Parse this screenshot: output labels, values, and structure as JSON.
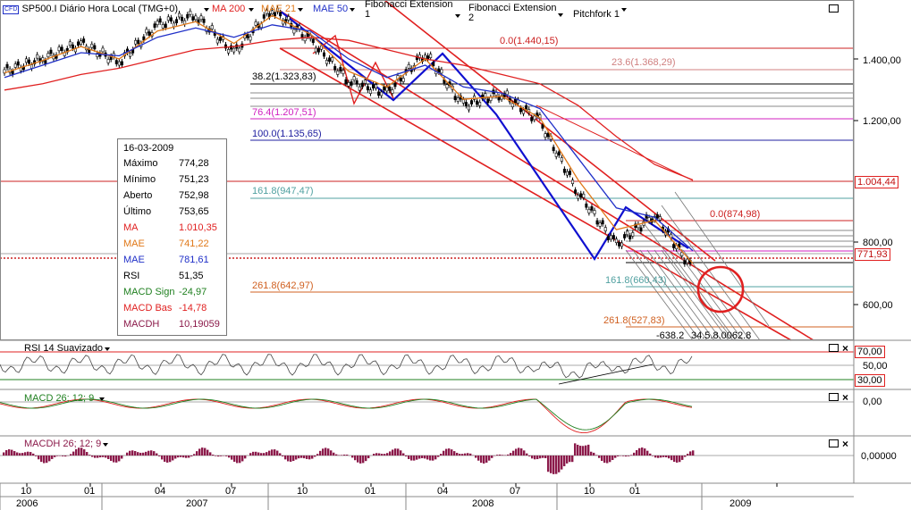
{
  "header": {
    "symbol_badge": "CFD",
    "title": "SP500.I Diário Hora Local (TMG+0)",
    "indicators": [
      {
        "label": "MA 200",
        "color": "#e02020"
      },
      {
        "label": "MAE 21",
        "color": "#e07818"
      },
      {
        "label": "MAE 50",
        "color": "#2030c8"
      },
      {
        "label": "Fibonacci Extension 1",
        "color": "#000000"
      },
      {
        "label": "Fibonacci Extension 2",
        "color": "#000000"
      },
      {
        "label": "Pitchfork 1",
        "color": "#000000"
      }
    ]
  },
  "info_panel": {
    "date": "16-03-2009",
    "rows": [
      {
        "label": "Máximo",
        "value": "774,28",
        "color": "#000000"
      },
      {
        "label": "Mínimo",
        "value": "751,23",
        "color": "#000000"
      },
      {
        "label": "Aberto",
        "value": "752,98",
        "color": "#000000"
      },
      {
        "label": "Último",
        "value": "753,65",
        "color": "#000000"
      },
      {
        "label": "MA",
        "value": "1.010,35",
        "color": "#e02020"
      },
      {
        "label": "MAE",
        "value": "741,22",
        "color": "#e07818"
      },
      {
        "label": "MAE",
        "value": "781,61",
        "color": "#2030c8"
      },
      {
        "label": "RSI",
        "value": "51,35",
        "color": "#000000"
      },
      {
        "label": "MACD Sign",
        "value": "-24,97",
        "color": "#208020"
      },
      {
        "label": "MACD Bas",
        "value": "-14,78",
        "color": "#e02020"
      },
      {
        "label": "MACDH",
        "value": "10,19059",
        "color": "#8b1a4a"
      }
    ]
  },
  "fib_levels": [
    {
      "label": "0.0(1.440,15)",
      "color": "#cc2020"
    },
    {
      "label": "23.6(1.368,29)",
      "color": "#d08080"
    },
    {
      "label": "38.2(1.323,83)",
      "color": "#000000"
    },
    {
      "label": "76.4(1.207,51)",
      "color": "#d020c0"
    },
    {
      "label": "100.0(1.135,65)",
      "color": "#2020a0"
    },
    {
      "label": "161.8(947,47)",
      "color": "#50a0a0"
    },
    {
      "label": "261.8(642,97)",
      "color": "#d06020"
    },
    {
      "label": "0.0(874,98)",
      "color": "#cc2020"
    },
    {
      "label": "161.8(660,43)",
      "color": "#50a0a0"
    },
    {
      "label": "261.8(527,83)",
      "color": "#d06020"
    },
    {
      "label": "-638.2",
      "color": "#000000"
    },
    {
      "label": "34.5.8.0062.8",
      "color": "#000000"
    }
  ],
  "price_axis": {
    "ticks": [
      "1.400,00",
      "1.200,00",
      "800,00",
      "600,00"
    ],
    "markers": [
      {
        "label": "1.004,44",
        "color": "#e02020"
      },
      {
        "label": "771,93",
        "color": "#e02020"
      }
    ]
  },
  "rsi_panel": {
    "title": "RSI 14 Suavizado",
    "ticks": [
      "70,00",
      "50,00",
      "30,00"
    ]
  },
  "macd_panel": {
    "title": "MACD 26; 12; 9",
    "ticks": [
      "0,00"
    ]
  },
  "macdh_panel": {
    "title": "MACDH 26; 12; 9",
    "ticks": [
      "0,00000"
    ]
  },
  "time_axis": {
    "months": [
      "10",
      "01",
      "04",
      "07",
      "10",
      "01",
      "04",
      "07",
      "10",
      "01"
    ],
    "years": [
      "2006",
      "2007",
      "2008",
      "2009"
    ]
  },
  "chart_data": {
    "type": "line",
    "title": "SP500.I Diário Hora Local (TMG+0)",
    "ylabel": "",
    "xlabel": "",
    "ylim": [
      520,
      1560
    ],
    "x": [
      "2006-10",
      "2006-12",
      "2007-02",
      "2007-03",
      "2007-05",
      "2007-07",
      "2007-08",
      "2007-10",
      "2007-11",
      "2008-01",
      "2008-03",
      "2008-05",
      "2008-07",
      "2008-08",
      "2008-09",
      "2008-10",
      "2008-11",
      "2009-01",
      "2009-03"
    ],
    "series": [
      {
        "name": "SP500.I",
        "values": [
          1360,
          1400,
          1450,
          1390,
          1510,
          1540,
          1420,
          1560,
          1460,
          1330,
          1290,
          1420,
          1250,
          1290,
          1200,
          970,
          800,
          900,
          720
        ]
      },
      {
        "name": "MA 200",
        "values": [
          1300,
          1320,
          1350,
          1370,
          1400,
          1430,
          1440,
          1460,
          1470,
          1460,
          1430,
          1400,
          1380,
          1350,
          1320,
          1250,
          1150,
          1060,
          1010
        ]
      },
      {
        "name": "MAE 21",
        "values": [
          1355,
          1395,
          1440,
          1400,
          1490,
          1520,
          1450,
          1540,
          1480,
          1360,
          1310,
          1400,
          1270,
          1280,
          1210,
          1010,
          850,
          880,
          741
        ]
      },
      {
        "name": "MAE 50",
        "values": [
          1340,
          1380,
          1420,
          1410,
          1470,
          1500,
          1470,
          1510,
          1490,
          1400,
          1340,
          1380,
          1310,
          1290,
          1240,
          1080,
          920,
          890,
          782
        ]
      }
    ]
  }
}
